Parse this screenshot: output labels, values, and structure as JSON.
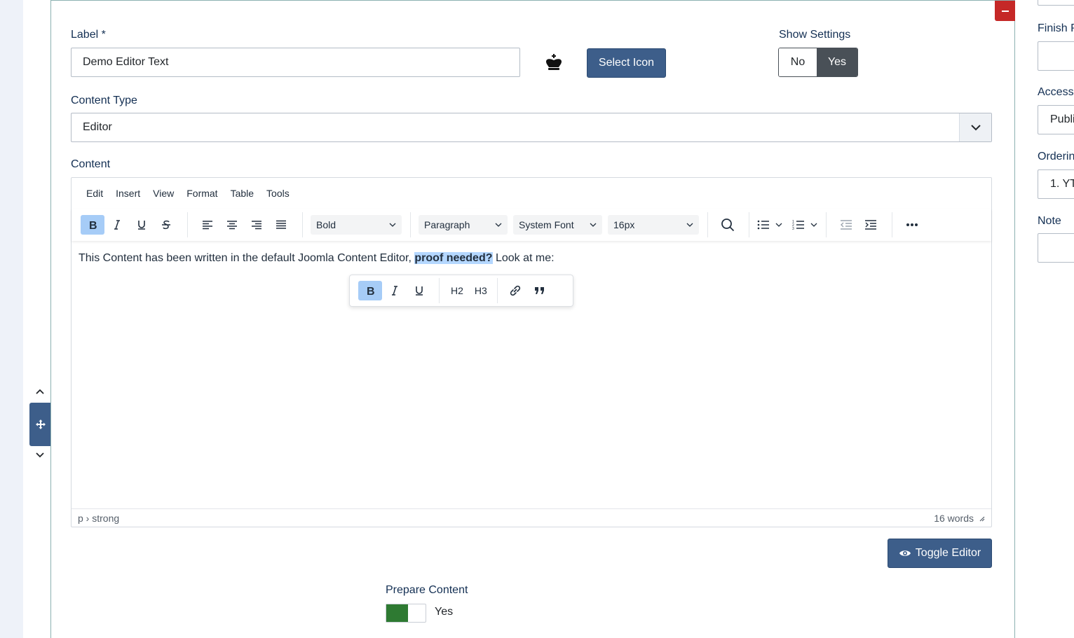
{
  "form": {
    "label_title": "Label *",
    "label_value": "Demo Editor Text",
    "select_icon_label": "Select Icon",
    "show_settings_title": "Show Settings",
    "show_settings_no": "No",
    "show_settings_yes": "Yes",
    "content_type_title": "Content Type",
    "content_type_value": "Editor",
    "content_title": "Content"
  },
  "editor": {
    "menu": [
      "Edit",
      "Insert",
      "View",
      "Format",
      "Table",
      "Tools"
    ],
    "block_select": "Bold",
    "format_select": "Paragraph",
    "font_select": "System Font",
    "size_select": "16px",
    "text_before": "This Content has been written in the default Joomla Content Editor, ",
    "text_selected": "proof needed?",
    "text_after": " Look at me:",
    "quick_h2": "H2",
    "quick_h3": "H3",
    "path": "p › strong",
    "word_count": "16 words"
  },
  "toggle_editor_label": "Toggle Editor",
  "prepare_content": {
    "title": "Prepare Content",
    "value": "Yes"
  },
  "sidebar": {
    "finish_label": "Finish P",
    "access_label": "Access",
    "access_value": "Publi",
    "ordering_label": "Orderin",
    "ordering_value": "1. YT",
    "note_label": "Note"
  },
  "colors": {
    "primary": "#3d5e8a",
    "danger": "#c52827",
    "success": "#2e7a32",
    "selection": "#b4d7ff"
  }
}
